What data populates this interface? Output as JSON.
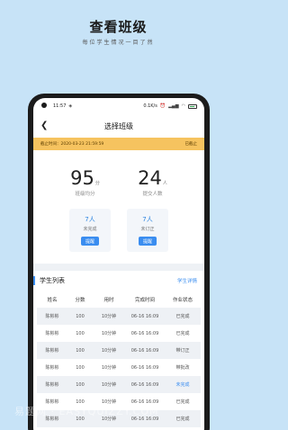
{
  "promo": {
    "title": "查看班级",
    "subtitle": "每位学生情况一目了然"
  },
  "status_bar": {
    "time": "11:57",
    "network_speed": "0.1K/s",
    "battery": "58"
  },
  "nav": {
    "title": "选择班级"
  },
  "notice": {
    "deadline": "截止时间：2020-03-23 21:59:59",
    "state": "已截止"
  },
  "stats": {
    "avg_score": {
      "value": "95",
      "unit": "分",
      "label": "班级均分"
    },
    "submitted": {
      "value": "24",
      "unit": "人",
      "label": "提交人数"
    }
  },
  "cards": [
    {
      "value": "7人",
      "label": "未完成",
      "button": "提醒"
    },
    {
      "value": "7人",
      "label": "未订正",
      "button": "提醒"
    }
  ],
  "student_list": {
    "title": "学生列表",
    "detail_link": "学生详情",
    "columns": [
      "姓名",
      "分数",
      "用时",
      "完成时间",
      "作业状态"
    ],
    "rows": [
      [
        "陈彬彬",
        "100",
        "10分钟",
        "06-16 16:09",
        "已完成"
      ],
      [
        "陈彬彬",
        "100",
        "10分钟",
        "06-16 16:09",
        "已完成"
      ],
      [
        "陈彬彬",
        "100",
        "10分钟",
        "06-16 16:09",
        "带订正"
      ],
      [
        "陈彬彬",
        "100",
        "10分钟",
        "06-16 16:09",
        "带批改"
      ],
      [
        "陈彬彬",
        "100",
        "10分钟",
        "06-16 16:09",
        "未完成"
      ],
      [
        "陈彬彬",
        "100",
        "10分钟",
        "06-16 16:09",
        "已完成"
      ],
      [
        "陈彬彬",
        "100",
        "10分钟",
        "06-16 16:09",
        "已完成"
      ]
    ],
    "highlight_status": "未完成"
  },
  "watermark": "易题网 · EASYQUIZZY.COM"
}
